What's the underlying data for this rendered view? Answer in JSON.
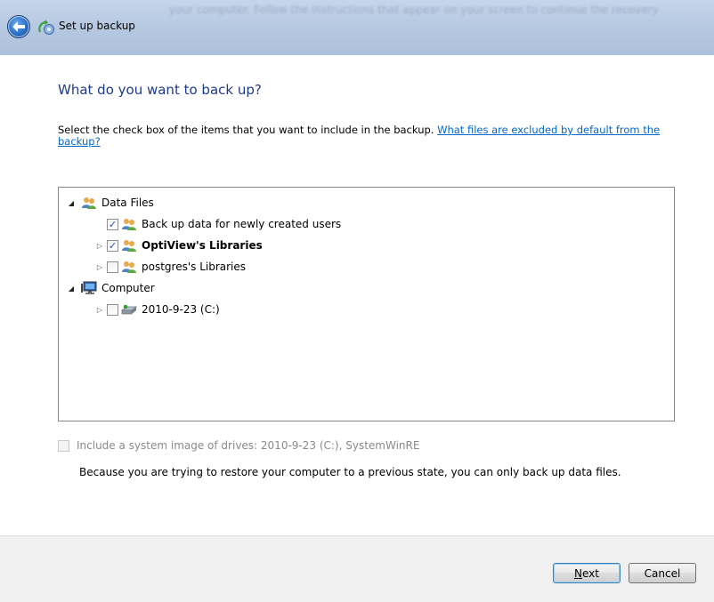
{
  "window": {
    "title": "Set up backup",
    "blurred_background_text": "your computer. Follow the instructions that appear on your screen to continue the recovery"
  },
  "page": {
    "heading": "What do you want to back up?",
    "instructions": "Select the check box of the items that you want to include in the backup. ",
    "link": "What files are excluded by default from the backup?"
  },
  "tree": {
    "data_files": {
      "label": "Data Files",
      "expanded": true
    },
    "new_users": {
      "label": "Back up data for newly created users",
      "checked": true
    },
    "optiview": {
      "label": "OptiView's Libraries",
      "checked": true
    },
    "postgres": {
      "label": "postgres's Libraries",
      "checked": false
    },
    "computer": {
      "label": "Computer",
      "expanded": true
    },
    "drive_c": {
      "label": "2010-9-23 (C:)",
      "checked": false
    }
  },
  "system_image": {
    "label": "Include a system image of drives: 2010-9-23 (C:), SystemWinRE",
    "checked": false,
    "enabled": false
  },
  "note": "Because you are trying to restore your computer to a previous state, you can only back up data files.",
  "buttons": {
    "next": "Next",
    "cancel": "Cancel"
  },
  "colors": {
    "heading": "#1e3a8a",
    "link": "#0066cc",
    "titlebar": "#b7c9e1"
  }
}
